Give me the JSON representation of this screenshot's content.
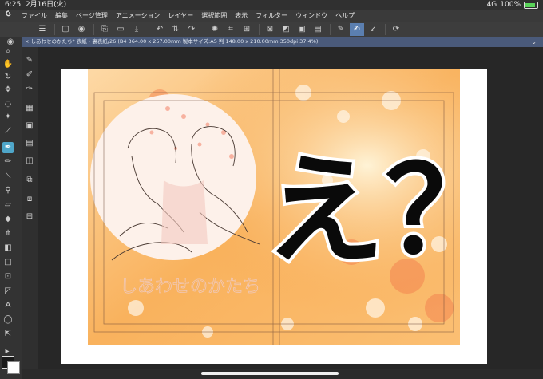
{
  "status": {
    "time": "6:25",
    "date": "2月16日(火)",
    "network": "4G",
    "battery": "100%"
  },
  "menu": [
    "ファイル",
    "編集",
    "ページ管理",
    "アニメーション",
    "レイヤー",
    "選択範囲",
    "表示",
    "フィルター",
    "ウィンドウ",
    "ヘルプ"
  ],
  "document": {
    "tab_title": "× しあわせのかたち*  表紙・裏表紙/26 (B4 364.00 x 257.00mm 製本サイズ:A5 判 148.00 x 210.00mm 350dpi 37.4%)"
  },
  "artwork": {
    "big_text": "え？",
    "title_outline": "しあわせのかたち",
    "colors": {
      "bg1": "#fbc98a",
      "bg2": "#f5a04a",
      "circle": "#fdf1ea",
      "text": "#0a0a0a"
    }
  },
  "icons": {
    "logo": "app-logo-icon",
    "toolbar": [
      "menu-icon",
      "new-icon",
      "view-icon",
      "export-icon",
      "open-icon",
      "save-icon",
      "undo-icon",
      "redo-icon",
      "transform-icon",
      "crop-icon",
      "fill-icon",
      "select-icon",
      "pen-tool-icon",
      "brush-icon",
      "correct-icon",
      "settings-icon"
    ],
    "tools": [
      "zoom-icon",
      "hand-icon",
      "rotate-icon",
      "move-icon",
      "lasso-icon",
      "magic-wand-icon",
      "eyedropper-icon",
      "pen-icon",
      "pencil-icon",
      "brush-icon",
      "airbrush-icon",
      "eraser-icon",
      "fill-icon",
      "gradient-icon",
      "figure-icon",
      "frame-icon",
      "ruler-icon",
      "text-icon",
      "balloon-icon",
      "correct-icon"
    ]
  }
}
